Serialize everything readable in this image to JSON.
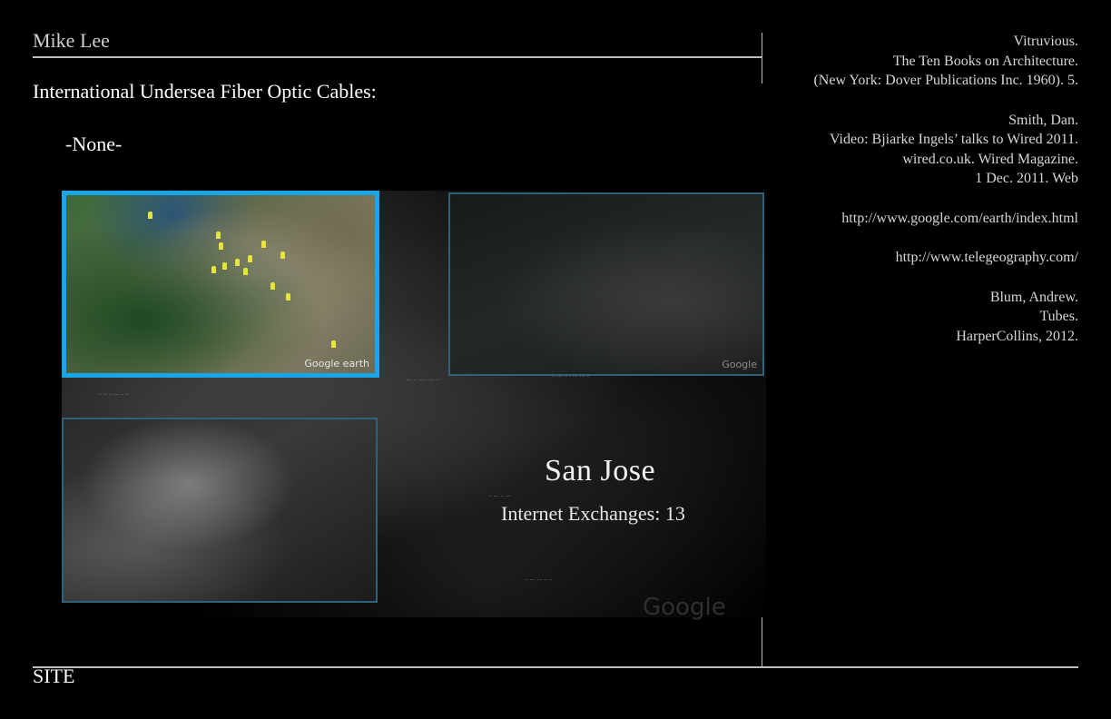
{
  "header": {
    "author": "Mike Lee"
  },
  "content": {
    "heading": "International Undersea Fiber Optic Cables:",
    "cables_value": "-None-"
  },
  "map": {
    "city": "San Jose",
    "exchanges": "Internet Exchanges: 13",
    "panel1_attribution": "Google earth",
    "panel2_attribution": "Google",
    "watermark": "Google"
  },
  "references": {
    "vitruvius": [
      "Vitruvious.",
      "The Ten Books on Architecture.",
      "(New York: Dover Publications Inc. 1960). 5."
    ],
    "smith": [
      "Smith, Dan.",
      "Video: Bjiarke Ingels’ talks to Wired 2011.",
      "wired.co.uk. Wired Magazine.",
      "1 Dec. 2011. Web"
    ],
    "google_url": "http://www.google.com/earth/index.html",
    "telegeo_url": "http://www.telegeography.com/",
    "blum": [
      "Blum, Andrew.",
      "Tubes.",
      "HarperCollins, 2012."
    ]
  },
  "footer": {
    "label": "SITE"
  },
  "colors": {
    "background": "#000000",
    "accent_frame": "#1aa5e6",
    "rule": "#bdbdbd"
  }
}
